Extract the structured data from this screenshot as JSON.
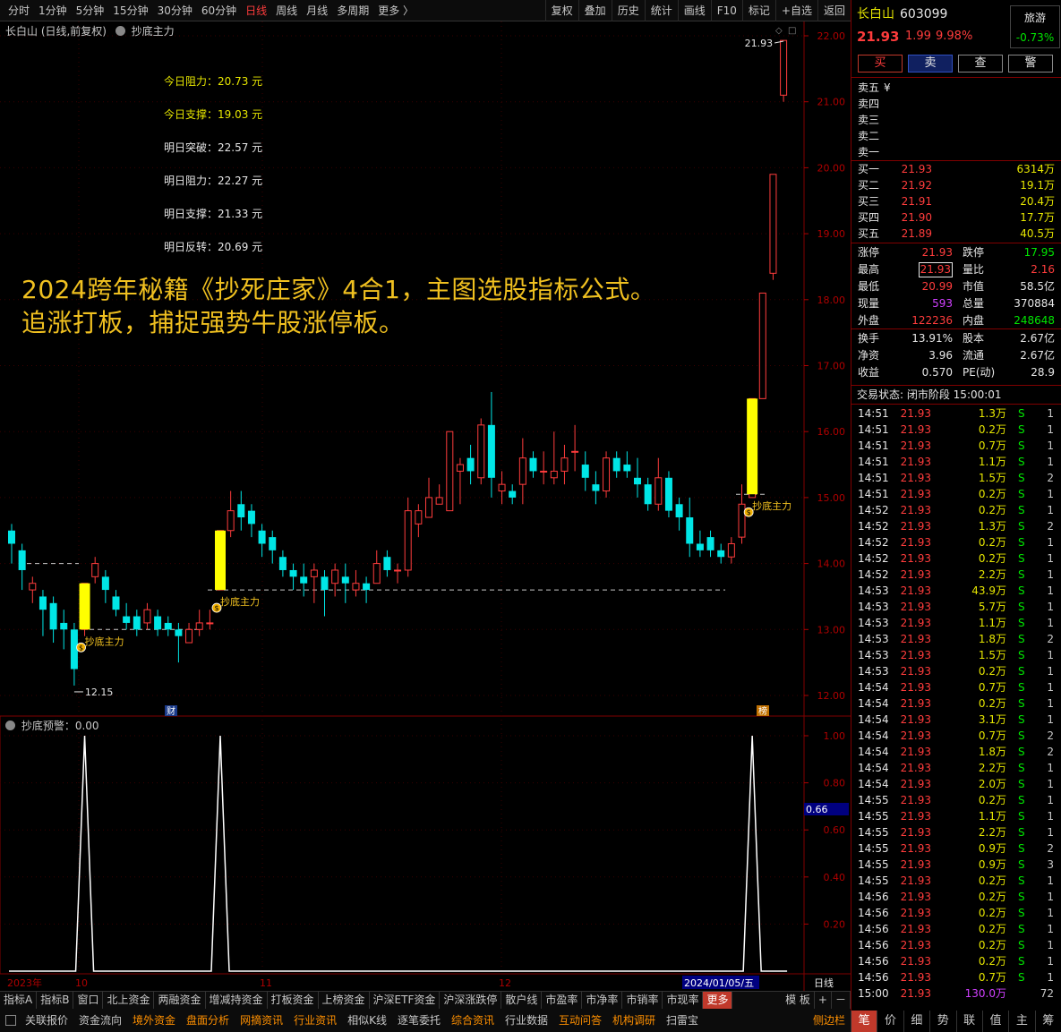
{
  "toolbar": {
    "periods": [
      "分时",
      "1分钟",
      "5分钟",
      "15分钟",
      "30分钟",
      "60分钟",
      "日线",
      "周线",
      "月线",
      "多周期",
      "更多 〉"
    ],
    "active_period": "日线",
    "tools": [
      "复权",
      "叠加",
      "历史",
      "统计",
      "画线",
      "F10",
      "标记",
      "+自选",
      "返回"
    ]
  },
  "chart_header": {
    "title": "长白山 (日线,前复权)",
    "indicator": "抄底主力"
  },
  "levels": [
    {
      "label": "今日阻力：20.73 元",
      "color": "#e6e600"
    },
    {
      "label": "今日支撑：19.03 元",
      "color": "#e6e600"
    },
    {
      "label": "明日突破：22.57 元",
      "color": "#e6e6e6"
    },
    {
      "label": "明日阻力：22.27 元",
      "color": "#e6e6e6"
    },
    {
      "label": "明日支撑：21.33 元",
      "color": "#e6e6e6"
    },
    {
      "label": "明日反转：20.69 元",
      "color": "#e6e6e6"
    }
  ],
  "promo": [
    "2024跨年秘籍《抄死庄家》4合1，主图选股指标公式。",
    "追涨打板，捕捉强势牛股涨停板。"
  ],
  "markers": {
    "high": "21.93",
    "low": "12.15",
    "signal": "抄底主力",
    "cai": "财",
    "bang": "榜"
  },
  "sub_header": "抄底预警：0.00",
  "sub_cursor": "0.66",
  "x_labels": {
    "y2023": "2023年",
    "m10": "10",
    "m11": "11",
    "m12": "12",
    "date": "2024/01/05/五",
    "period": "日线"
  },
  "chart_data": {
    "type": "candlestick",
    "ylim": [
      11.8,
      22.1
    ],
    "yticks": [
      "22.00",
      "21.00",
      "20.00",
      "19.00",
      "18.00",
      "17.00",
      "16.00",
      "15.00",
      "14.00",
      "13.00",
      "12.00"
    ],
    "candles": [
      [
        14.5,
        14.3,
        14.6,
        14.0
      ],
      [
        14.2,
        13.9,
        14.3,
        13.6
      ],
      [
        13.6,
        13.7,
        13.8,
        13.4
      ],
      [
        13.5,
        13.3,
        13.6,
        12.9
      ],
      [
        13.4,
        13.0,
        13.5,
        12.8
      ],
      [
        13.1,
        13.0,
        13.3,
        12.7
      ],
      [
        13.0,
        12.4,
        13.1,
        12.15
      ],
      [
        13.0,
        13.7,
        13.7,
        12.9
      ],
      [
        13.8,
        14.0,
        14.1,
        13.7
      ],
      [
        13.8,
        13.6,
        13.9,
        13.4
      ],
      [
        13.5,
        13.3,
        13.6,
        13.2
      ],
      [
        13.2,
        13.1,
        13.4,
        13.0
      ],
      [
        13.2,
        13.0,
        13.3,
        12.9
      ],
      [
        13.1,
        13.3,
        13.4,
        13.0
      ],
      [
        13.2,
        13.0,
        13.3,
        12.9
      ],
      [
        13.1,
        13.0,
        13.2,
        12.9
      ],
      [
        13.0,
        12.9,
        13.1,
        12.5
      ],
      [
        12.8,
        13.0,
        13.1,
        12.8
      ],
      [
        13.0,
        13.1,
        13.3,
        12.9
      ],
      [
        13.1,
        13.1,
        13.3,
        13.0
      ],
      [
        13.6,
        14.5,
        14.5,
        13.6
      ],
      [
        14.5,
        14.8,
        15.1,
        14.4
      ],
      [
        14.9,
        14.7,
        15.1,
        14.5
      ],
      [
        14.8,
        14.6,
        14.9,
        14.4
      ],
      [
        14.5,
        14.3,
        14.6,
        14.1
      ],
      [
        14.4,
        14.2,
        14.5,
        14.0
      ],
      [
        14.1,
        13.9,
        14.2,
        13.8
      ],
      [
        13.9,
        13.8,
        14.0,
        13.6
      ],
      [
        13.8,
        13.7,
        14.0,
        13.5
      ],
      [
        13.8,
        13.9,
        14.0,
        13.4
      ],
      [
        13.8,
        13.6,
        13.9,
        13.2
      ],
      [
        13.7,
        13.9,
        14.0,
        13.5
      ],
      [
        13.8,
        13.7,
        14.0,
        13.4
      ],
      [
        13.6,
        13.7,
        13.9,
        13.5
      ],
      [
        13.7,
        13.6,
        13.8,
        13.4
      ],
      [
        13.7,
        14.0,
        14.2,
        13.7
      ],
      [
        14.1,
        13.9,
        14.2,
        13.8
      ],
      [
        13.9,
        13.9,
        14.0,
        13.7
      ],
      [
        13.9,
        14.8,
        15.0,
        13.8
      ],
      [
        14.6,
        14.8,
        14.9,
        14.4
      ],
      [
        14.7,
        15.0,
        15.3,
        14.7
      ],
      [
        14.9,
        15.0,
        15.2,
        14.9
      ],
      [
        14.8,
        16.0,
        16.0,
        14.8
      ],
      [
        15.4,
        15.5,
        15.6,
        14.9
      ],
      [
        15.6,
        15.4,
        15.8,
        15.2
      ],
      [
        15.3,
        16.1,
        16.2,
        15.2
      ],
      [
        16.1,
        15.3,
        16.6,
        15.0
      ],
      [
        15.1,
        15.2,
        15.4,
        14.9
      ],
      [
        15.1,
        15.0,
        15.2,
        14.9
      ],
      [
        15.2,
        15.6,
        15.9,
        14.9
      ],
      [
        15.6,
        15.4,
        15.7,
        15.3
      ],
      [
        15.4,
        15.4,
        15.7,
        15.2
      ],
      [
        15.3,
        15.4,
        16.0,
        15.2
      ],
      [
        15.4,
        15.6,
        15.8,
        15.2
      ],
      [
        15.7,
        15.7,
        16.1,
        15.4
      ],
      [
        15.5,
        15.3,
        15.7,
        15.1
      ],
      [
        15.2,
        15.1,
        15.4,
        14.9
      ],
      [
        15.1,
        15.6,
        15.7,
        15.0
      ],
      [
        15.6,
        15.4,
        15.7,
        15.3
      ],
      [
        15.5,
        15.4,
        15.7,
        15.3
      ],
      [
        15.3,
        15.2,
        15.6,
        15.0
      ],
      [
        15.2,
        14.9,
        15.3,
        14.8
      ],
      [
        14.9,
        15.3,
        15.6,
        14.8
      ],
      [
        15.3,
        14.8,
        15.4,
        14.7
      ],
      [
        14.9,
        14.7,
        15.0,
        14.5
      ],
      [
        14.7,
        14.3,
        15.0,
        14.1
      ],
      [
        14.3,
        14.2,
        14.5,
        14.1
      ],
      [
        14.4,
        14.2,
        14.5,
        14.1
      ],
      [
        14.2,
        14.1,
        14.3,
        14.0
      ],
      [
        14.1,
        14.3,
        14.4,
        14.0
      ],
      [
        14.4,
        14.9,
        15.2,
        14.3
      ],
      [
        15.0,
        16.5,
        16.5,
        15.0
      ],
      [
        16.5,
        18.1,
        18.1,
        16.5
      ],
      [
        18.4,
        19.9,
        19.9,
        18.3
      ],
      [
        21.1,
        21.93,
        21.93,
        21.0
      ]
    ],
    "yellow_bars": [
      {
        "index": 7,
        "low": 13.0,
        "high": 13.7
      },
      {
        "index": 20,
        "low": 13.6,
        "high": 14.5
      },
      {
        "index": 71,
        "low": 15.05,
        "high": 16.5
      }
    ],
    "signal_points": [
      7,
      20,
      71
    ],
    "sub_ylim": [
      0,
      1.05
    ],
    "sub_yticks": [
      "1.00",
      "0.80",
      "0.60",
      "0.40",
      "0.20"
    ],
    "sub_series": [
      {
        "peaks_at": [
          7,
          20,
          71
        ],
        "peak_value": 1.0
      }
    ]
  },
  "quote": {
    "name": "长白山",
    "code": "603099",
    "tag": "旅游",
    "tag_change": "-0.73%",
    "price": "21.93",
    "change": "1.99",
    "pct": "9.98%",
    "buttons": [
      "买",
      "卖",
      "查",
      "警"
    ],
    "asks": [
      {
        "label": "卖五",
        "price": "¥",
        "vol": ""
      },
      {
        "label": "卖四",
        "price": "",
        "vol": ""
      },
      {
        "label": "卖三",
        "price": "",
        "vol": ""
      },
      {
        "label": "卖二",
        "price": "",
        "vol": ""
      },
      {
        "label": "卖一",
        "price": "",
        "vol": ""
      }
    ],
    "bids": [
      {
        "label": "买一",
        "price": "21.93",
        "vol": "6314万"
      },
      {
        "label": "买二",
        "price": "21.92",
        "vol": "19.1万"
      },
      {
        "label": "买三",
        "price": "21.91",
        "vol": "20.4万"
      },
      {
        "label": "买四",
        "price": "21.90",
        "vol": "17.7万"
      },
      {
        "label": "买五",
        "price": "21.89",
        "vol": "40.5万"
      }
    ],
    "stats": [
      {
        "k1": "涨停",
        "v1": "21.93",
        "c1": "red",
        "k2": "跌停",
        "v2": "17.95",
        "c2": "green"
      },
      {
        "k1": "最高",
        "v1": "21.93",
        "c1": "red",
        "k2": "量比",
        "v2": "2.16",
        "c2": "red"
      },
      {
        "k1": "最低",
        "v1": "20.99",
        "c1": "red",
        "k2": "市值",
        "v2": "58.5亿",
        "c2": "white"
      },
      {
        "k1": "现量",
        "v1": "593",
        "c1": "purple",
        "k2": "总量",
        "v2": "370884",
        "c2": "white"
      },
      {
        "k1": "外盘",
        "v1": "122236",
        "c1": "red",
        "k2": "内盘",
        "v2": "248648",
        "c2": "green"
      }
    ],
    "stats2": [
      {
        "k1": "换手",
        "v1": "13.91%",
        "k2": "股本",
        "v2": "2.67亿"
      },
      {
        "k1": "净资",
        "v1": "3.96",
        "k2": "流通",
        "v2": "2.67亿"
      },
      {
        "k1": "收益",
        "v1": "0.570",
        "k2": "PE(动)",
        "v2": "28.9"
      }
    ],
    "status": "交易状态: 闭市阶段 15:00:01",
    "ticks": [
      [
        "14:51",
        "21.93",
        "1.3万",
        "S",
        "1"
      ],
      [
        "14:51",
        "21.93",
        "0.2万",
        "S",
        "1"
      ],
      [
        "14:51",
        "21.93",
        "0.7万",
        "S",
        "1"
      ],
      [
        "14:51",
        "21.93",
        "1.1万",
        "S",
        "1"
      ],
      [
        "14:51",
        "21.93",
        "1.5万",
        "S",
        "2"
      ],
      [
        "14:51",
        "21.93",
        "0.2万",
        "S",
        "1"
      ],
      [
        "14:52",
        "21.93",
        "0.2万",
        "S",
        "1"
      ],
      [
        "14:52",
        "21.93",
        "1.3万",
        "S",
        "2"
      ],
      [
        "14:52",
        "21.93",
        "0.2万",
        "S",
        "1"
      ],
      [
        "14:52",
        "21.93",
        "0.2万",
        "S",
        "1"
      ],
      [
        "14:52",
        "21.93",
        "2.2万",
        "S",
        "1"
      ],
      [
        "14:53",
        "21.93",
        "43.9万",
        "S",
        "1"
      ],
      [
        "14:53",
        "21.93",
        "5.7万",
        "S",
        "1"
      ],
      [
        "14:53",
        "21.93",
        "1.1万",
        "S",
        "1"
      ],
      [
        "14:53",
        "21.93",
        "1.8万",
        "S",
        "2"
      ],
      [
        "14:53",
        "21.93",
        "1.5万",
        "S",
        "1"
      ],
      [
        "14:53",
        "21.93",
        "0.2万",
        "S",
        "1"
      ],
      [
        "14:54",
        "21.93",
        "0.7万",
        "S",
        "1"
      ],
      [
        "14:54",
        "21.93",
        "0.2万",
        "S",
        "1"
      ],
      [
        "14:54",
        "21.93",
        "3.1万",
        "S",
        "1"
      ],
      [
        "14:54",
        "21.93",
        "0.7万",
        "S",
        "2"
      ],
      [
        "14:54",
        "21.93",
        "1.8万",
        "S",
        "2"
      ],
      [
        "14:54",
        "21.93",
        "2.2万",
        "S",
        "1"
      ],
      [
        "14:54",
        "21.93",
        "2.0万",
        "S",
        "1"
      ],
      [
        "14:55",
        "21.93",
        "0.2万",
        "S",
        "1"
      ],
      [
        "14:55",
        "21.93",
        "1.1万",
        "S",
        "1"
      ],
      [
        "14:55",
        "21.93",
        "2.2万",
        "S",
        "1"
      ],
      [
        "14:55",
        "21.93",
        "0.9万",
        "S",
        "2"
      ],
      [
        "14:55",
        "21.93",
        "0.9万",
        "S",
        "3"
      ],
      [
        "14:55",
        "21.93",
        "0.2万",
        "S",
        "1"
      ],
      [
        "14:56",
        "21.93",
        "0.2万",
        "S",
        "1"
      ],
      [
        "14:56",
        "21.93",
        "0.2万",
        "S",
        "1"
      ],
      [
        "14:56",
        "21.93",
        "0.2万",
        "S",
        "1"
      ],
      [
        "14:56",
        "21.93",
        "0.2万",
        "S",
        "1"
      ],
      [
        "14:56",
        "21.93",
        "0.2万",
        "S",
        "1"
      ],
      [
        "14:56",
        "21.93",
        "0.7万",
        "S",
        "1"
      ],
      [
        "15:00",
        "21.93",
        "130.0万",
        "",
        "72"
      ]
    ],
    "tabs": [
      "笔",
      "价",
      "细",
      "势",
      "联",
      "值",
      "主",
      "筹"
    ]
  },
  "bottom_tabs1": [
    "指标A",
    "指标B",
    "窗口",
    "北上资金",
    "两融资金",
    "增减持资金",
    "打板资金",
    "上榜资金",
    "沪深ETF资金",
    "沪深涨跌停",
    "散户线",
    "市盈率",
    "市净率",
    "市销率",
    "市现率",
    "更多",
    "模 板",
    "+",
    "－"
  ],
  "bottom_tabs2": [
    "关联报价",
    "资金流向",
    "境外资金",
    "盘面分析",
    "网摘资讯",
    "行业资讯",
    "相似K线",
    "逐笔委托",
    "综合资讯",
    "行业数据",
    "互动问答",
    "机构调研",
    "扫雷宝",
    "侧边栏"
  ]
}
